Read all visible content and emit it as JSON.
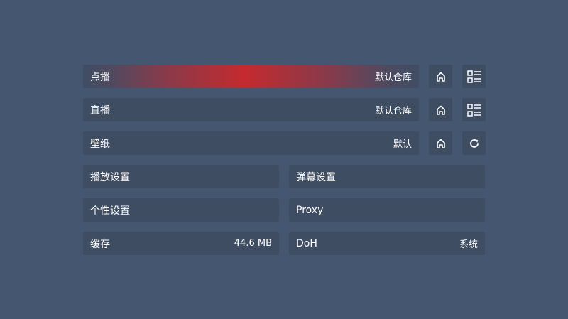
{
  "rows": {
    "vod": {
      "label": "点播",
      "value": "默认仓库"
    },
    "live": {
      "label": "直播",
      "value": "默认仓库"
    },
    "wallpaper": {
      "label": "壁纸",
      "value": "默认"
    }
  },
  "grid": {
    "player_settings": {
      "label": "播放设置"
    },
    "danmaku_settings": {
      "label": "弹幕设置"
    },
    "personal_settings": {
      "label": "个性设置"
    },
    "proxy": {
      "label": "Proxy"
    },
    "cache": {
      "label": "缓存",
      "value": "44.6 MB"
    },
    "doh": {
      "label": "DoH",
      "value": "系统"
    }
  },
  "icons": {
    "home": "home-icon",
    "list": "list-icon",
    "refresh": "refresh-icon"
  },
  "colors": {
    "background": "#455770",
    "tile": "#3f4d63",
    "focus_accent": "#c42a2f",
    "text": "#ffffff"
  }
}
